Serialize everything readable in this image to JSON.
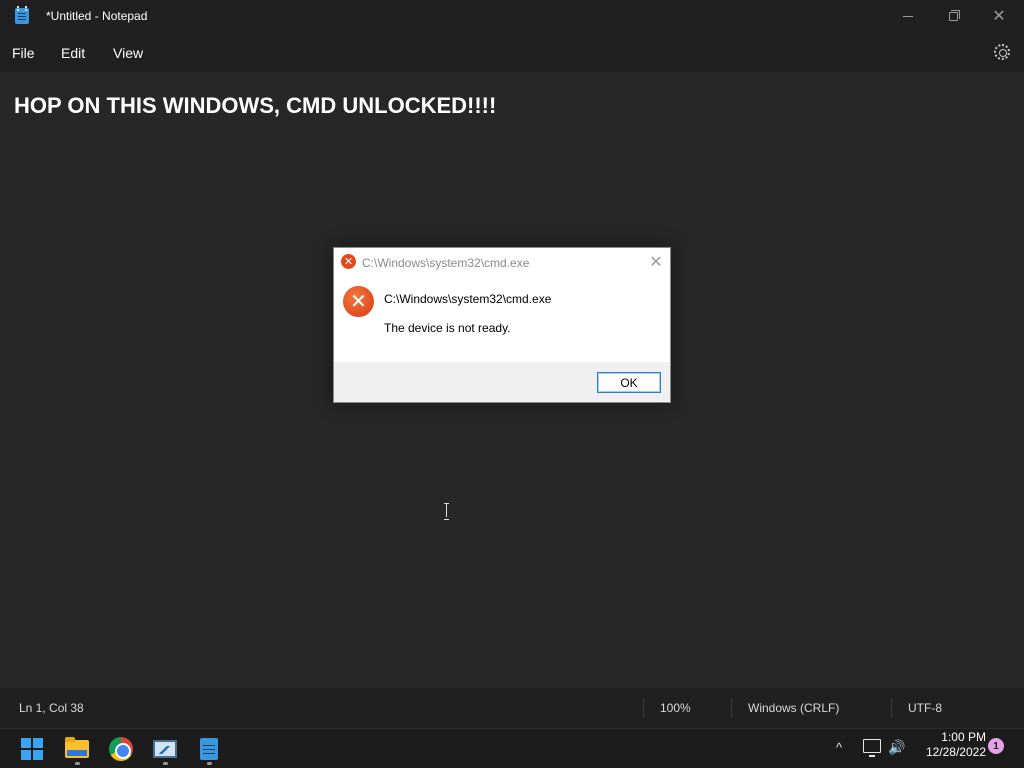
{
  "window": {
    "title": "*Untitled - Notepad",
    "app_icon": "notepad-icon"
  },
  "menu": {
    "file": "File",
    "edit": "Edit",
    "view": "View",
    "settings_icon": "gear-icon"
  },
  "editor": {
    "content": "HOP ON THIS WINDOWS, CMD UNLOCKED!!!!"
  },
  "status": {
    "position": "Ln 1, Col 38",
    "zoom": "100%",
    "line_ending": "Windows (CRLF)",
    "encoding": "UTF-8"
  },
  "dialog": {
    "title": "C:\\Windows\\system32\\cmd.exe",
    "heading": "C:\\Windows\\system32\\cmd.exe",
    "message": "The device is not ready.",
    "ok_label": "OK",
    "icon": "error-icon",
    "close_glyph": "✕",
    "icon_glyph": "✕"
  },
  "taskbar": {
    "apps": [
      "start",
      "file-explorer",
      "chrome",
      "task-manager",
      "notepad"
    ],
    "time": "1:00 PM",
    "date": "12/28/2022",
    "notification_count": "1",
    "chevron_glyph": "^",
    "volume_glyph": "🔊"
  },
  "colors": {
    "editor_bg": "#272727",
    "chrome_bg": "#202020",
    "accent": "#38a4f2",
    "error": "#e04a1f"
  }
}
